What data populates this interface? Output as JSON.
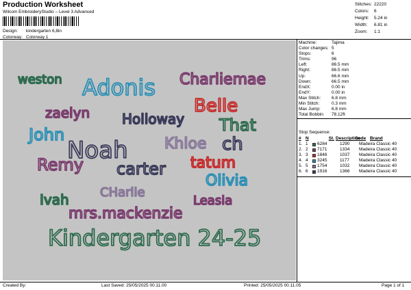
{
  "header": {
    "title": "Production Worksheet",
    "subtitle": "Wilcom EmbroideryStudio – Level 3 Advanced",
    "design_label": "Design:",
    "design_value": "kindergarten 6,8in",
    "colorway_label": "Colorway:",
    "colorway_value": "Colorway 1"
  },
  "top_stats": [
    {
      "key": "Stitches:",
      "value": "22220"
    },
    {
      "key": "Colors:",
      "value": "6"
    },
    {
      "key": "Height:",
      "value": "5.24 in"
    },
    {
      "key": "Width:",
      "value": "6.81 in"
    },
    {
      "key": "Zoom:",
      "value": "1:1"
    }
  ],
  "machine_info": [
    {
      "key": "Machine:",
      "value": "Tajima"
    },
    {
      "key": "Color changes:",
      "value": "5"
    },
    {
      "key": "Stops:",
      "value": "6"
    },
    {
      "key": "Trims:",
      "value": "96"
    },
    {
      "key": "Left:",
      "value": "86.5 mm"
    },
    {
      "key": "Right:",
      "value": "86.5 mm"
    },
    {
      "key": "Up:",
      "value": "66.6 mm"
    },
    {
      "key": "Down:",
      "value": "66.5 mm"
    },
    {
      "key": "EndX:",
      "value": "0.00 in"
    },
    {
      "key": "EndY:",
      "value": "0.00 in"
    },
    {
      "key": "Max Stitch:",
      "value": "6.8 mm"
    },
    {
      "key": "Min Stitch:",
      "value": "0.3 mm"
    },
    {
      "key": "Max Jump:",
      "value": "6.8 mm"
    },
    {
      "key": "Total Bobbin:",
      "value": "78.12ft"
    }
  ],
  "stop_sequence": {
    "title": "Stop Sequence:",
    "headers": [
      "#",
      "N",
      "",
      "St.",
      "Description",
      "Code",
      "Brand"
    ],
    "rows": [
      {
        "num": "1.",
        "n": "1",
        "color": "#2e6b4e",
        "code": "6284",
        "st": "1290",
        "brand": "Madeira Classic 40"
      },
      {
        "num": "2.",
        "n": "2",
        "color": "#7a3d6e",
        "code": "7171",
        "st": "1334",
        "brand": "Madeira Classic 40"
      },
      {
        "num": "3.",
        "n": "3",
        "color": "#c62a2a",
        "code": "1848",
        "st": "1037",
        "brand": "Madeira Classic 40"
      },
      {
        "num": "4.",
        "n": "4",
        "color": "#2a8fb5",
        "code": "3245",
        "st": "1177",
        "brand": "Madeira Classic 40"
      },
      {
        "num": "5.",
        "n": "5",
        "color": "#8a7a9a",
        "code": "1754",
        "st": "1032",
        "brand": "Madeira Classic 40"
      },
      {
        "num": "6.",
        "n": "6",
        "color": "#3a3a5a",
        "code": "1916",
        "st": "1366",
        "brand": "Madeira Classic 40"
      }
    ]
  },
  "design_names": {
    "weston": "weston",
    "adonis": "Adonis",
    "charliemae": "Charliemae",
    "belle": "Belle",
    "zaelyn": "zaelyn",
    "holloway": "Holloway",
    "that": "That",
    "john": "John",
    "noah": "Noah",
    "khloe": "Khloe",
    "ch": "ch",
    "rem": "Remy",
    "carter": "carter",
    "tatum": "tatum",
    "olivia": "Olivia",
    "ivah": "Ivah",
    "charlie": "CHarlie",
    "leasia": "Leasia",
    "mrs": "mrs.mackenzie",
    "kindergarten": "Kindergarten 24-25"
  },
  "footer": {
    "created_by": "Created By:",
    "last_saved": "Last Saved: 25/05/2025 00.11.00",
    "printed": "Printed: 25/05/2025 00.11.05",
    "page": "Page 1 of 1"
  }
}
